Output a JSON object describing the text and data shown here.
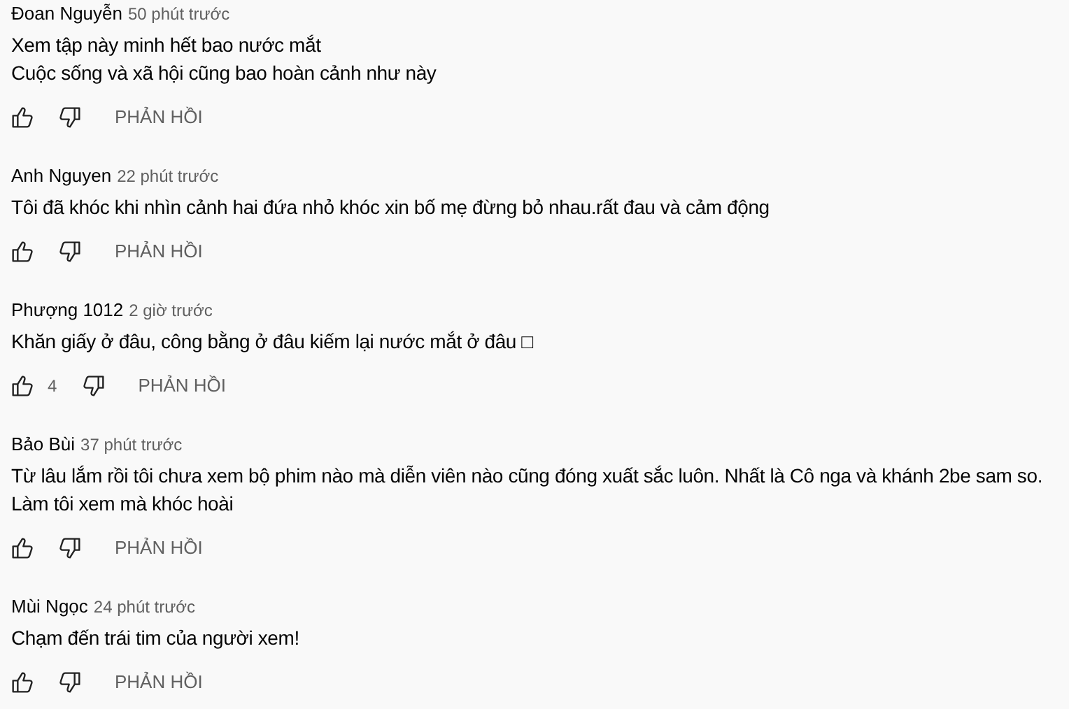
{
  "comments": [
    {
      "author": "Đoan Nguyễn",
      "time": "50 phút trước",
      "lines": [
        "Xem tập này minh hết bao nước mắt",
        "Cuộc sống và xã hội cũng bao hoàn cảnh như này"
      ],
      "reply": "PHẢN HỒI"
    },
    {
      "author": "Anh Nguyen",
      "time": "22 phút trước",
      "lines": [
        "Tôi đã khóc khi nhìn cảnh hai đứa nhỏ khóc xin bố mẹ đừng bỏ nhau.rất đau và cảm động"
      ],
      "reply": "PHẢN HỒI"
    },
    {
      "author": "Phượng 1012",
      "time": "2 giờ trước",
      "lines": [
        "Khăn giấy ở đâu, công bằng ở đâu kiếm lại nước mắt ở đâu □"
      ],
      "likes": "4",
      "reply": "PHẢN HỒI"
    },
    {
      "author": "Bảo Bùi",
      "time": "37 phút trước",
      "lines": [
        "Từ lâu lắm rồi tôi chưa xem bộ phim nào mà diễn viên nào cũng đóng xuất sắc luôn. Nhất là Cô nga và khánh 2be sam so.",
        "Làm tôi xem mà khóc hoài"
      ],
      "reply": "PHẢN HỒI"
    },
    {
      "author": "Mùi Ngọc",
      "time": "24 phút trước",
      "lines": [
        "Chạm đến trái tim của người xem!"
      ],
      "reply": "PHẢN HỒI"
    }
  ]
}
